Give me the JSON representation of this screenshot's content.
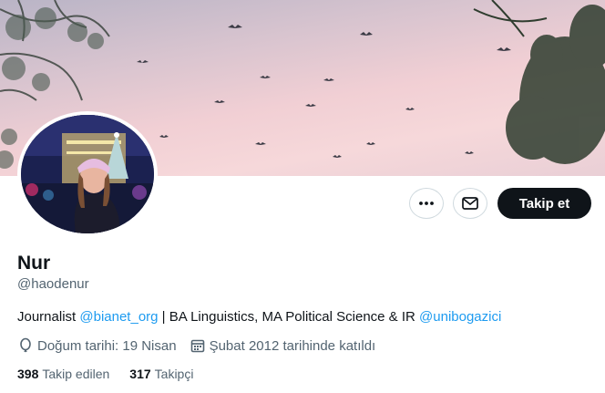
{
  "profile": {
    "name": "Nur",
    "handle": "@haodenur",
    "bio": {
      "prefix": "Journalist ",
      "mention1": "@bianet_org",
      "middle": " | BA Linguistics, MA Political Science & IR ",
      "mention2": "@unibogazici"
    },
    "birthday": "Doğum tarihi: 19 Nisan",
    "joined": "Şubat 2012 tarihinde katıldı",
    "following_count": "398",
    "following_label": "Takip edilen",
    "followers_count": "317",
    "followers_label": "Takipçi"
  },
  "actions": {
    "follow_label": "Takip et",
    "more_icon": "more-horizontal-icon",
    "message_icon": "envelope-icon"
  },
  "colors": {
    "link": "#1d9bf0",
    "follow_button_bg": "#0f1419",
    "secondary_text": "#536471"
  }
}
